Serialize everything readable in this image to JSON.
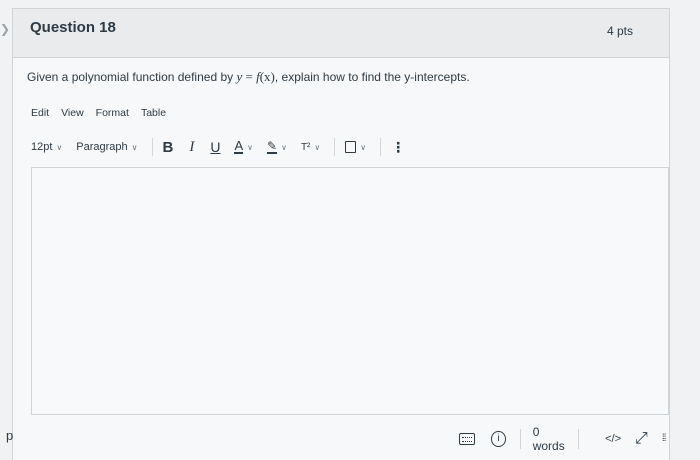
{
  "question": {
    "title": "Question 18",
    "points": "4 pts",
    "prompt_before": "Given a polynomial function defined by ",
    "prompt_math": {
      "y": "y",
      "eq": " = ",
      "f": "f",
      "arg": "(x)"
    },
    "prompt_after": ", explain how to find the y-intercepts."
  },
  "editor": {
    "menu": [
      "Edit",
      "View",
      "Format",
      "Table"
    ],
    "toolbar": {
      "font_size": "12pt",
      "block_format": "Paragraph",
      "bold": "B",
      "italic": "I",
      "underline": "U",
      "text_color": "A",
      "superscript": "T²"
    },
    "status": {
      "word_count": "0 words",
      "html_toggle": "</>"
    }
  },
  "page": {
    "footer_letter": "p"
  }
}
